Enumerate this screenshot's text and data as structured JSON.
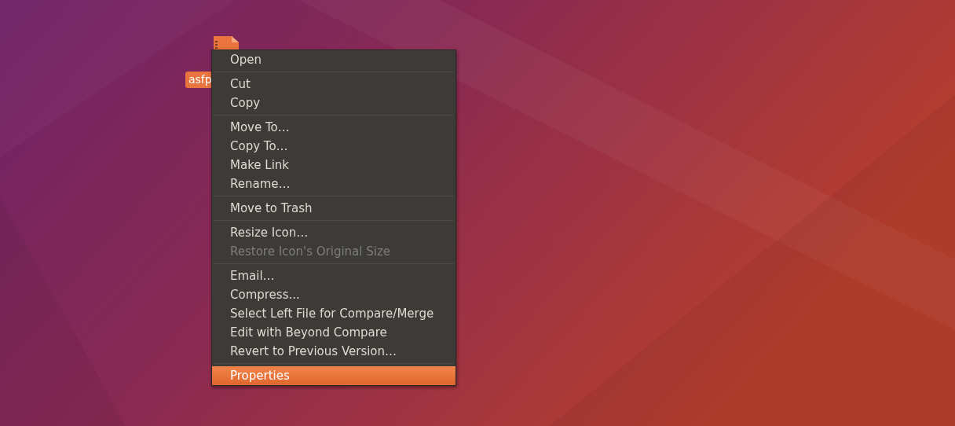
{
  "desktop_icon": {
    "label": "asfp"
  },
  "context_menu": {
    "items": [
      {
        "kind": "item",
        "label": "Open",
        "disabled": false,
        "selected": false
      },
      {
        "kind": "separator"
      },
      {
        "kind": "item",
        "label": "Cut",
        "disabled": false,
        "selected": false
      },
      {
        "kind": "item",
        "label": "Copy",
        "disabled": false,
        "selected": false
      },
      {
        "kind": "separator"
      },
      {
        "kind": "item",
        "label": "Move To…",
        "disabled": false,
        "selected": false
      },
      {
        "kind": "item",
        "label": "Copy To…",
        "disabled": false,
        "selected": false
      },
      {
        "kind": "item",
        "label": "Make Link",
        "disabled": false,
        "selected": false
      },
      {
        "kind": "item",
        "label": "Rename…",
        "disabled": false,
        "selected": false
      },
      {
        "kind": "separator"
      },
      {
        "kind": "item",
        "label": "Move to Trash",
        "disabled": false,
        "selected": false
      },
      {
        "kind": "separator"
      },
      {
        "kind": "item",
        "label": "Resize Icon…",
        "disabled": false,
        "selected": false
      },
      {
        "kind": "item",
        "label": "Restore Icon's Original Size",
        "disabled": true,
        "selected": false
      },
      {
        "kind": "separator"
      },
      {
        "kind": "item",
        "label": "Email…",
        "disabled": false,
        "selected": false
      },
      {
        "kind": "item",
        "label": "Compress...",
        "disabled": false,
        "selected": false
      },
      {
        "kind": "item",
        "label": "Select Left File for Compare/Merge",
        "disabled": false,
        "selected": false
      },
      {
        "kind": "item",
        "label": "Edit with Beyond Compare",
        "disabled": false,
        "selected": false
      },
      {
        "kind": "item",
        "label": "Revert to Previous Version…",
        "disabled": false,
        "selected": false
      },
      {
        "kind": "separator"
      },
      {
        "kind": "item",
        "label": "Properties",
        "disabled": false,
        "selected": true
      }
    ]
  }
}
